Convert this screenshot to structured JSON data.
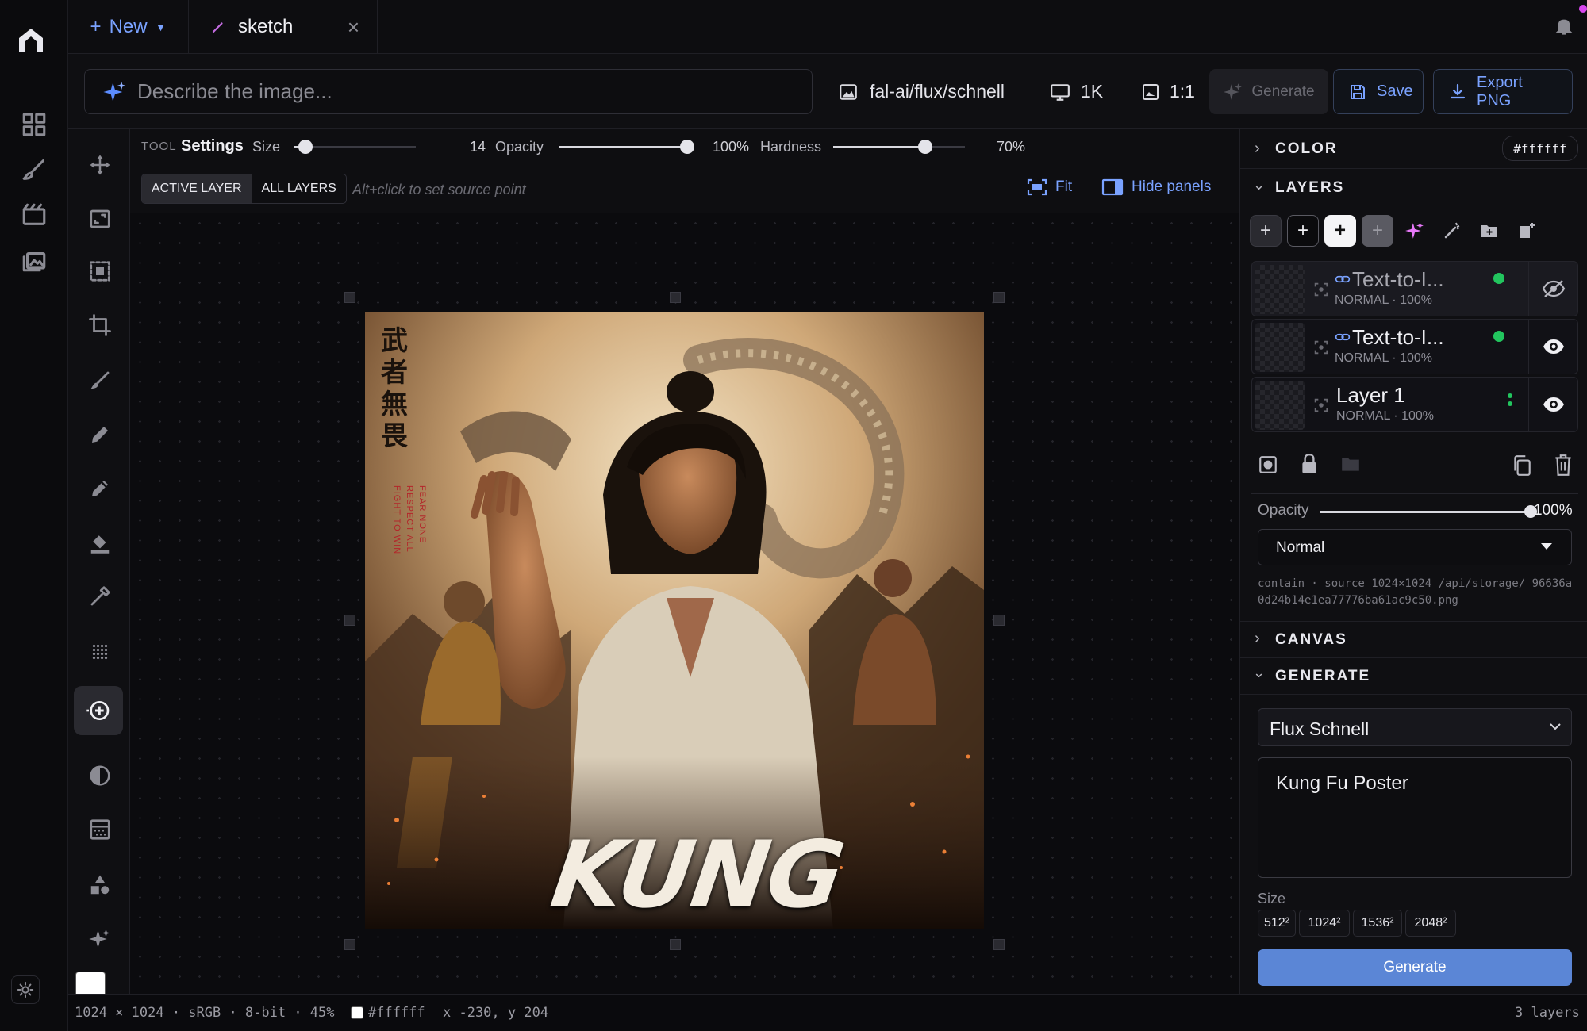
{
  "tabs": {
    "new_label": "New",
    "active_tab": "sketch"
  },
  "prompt": {
    "placeholder": "Describe the image..."
  },
  "toolbar": {
    "model": "fal-ai/flux/schnell",
    "resolution": "1K",
    "aspect": "1:1",
    "generate": "Generate",
    "save": "Save",
    "export": "Export PNG"
  },
  "options": {
    "tool_caption": "TOOL",
    "settings": "Settings",
    "size_label": "Size",
    "size_value": "14",
    "size_fraction": 0.1,
    "opacity_label": "Opacity",
    "opacity_value": "100%",
    "opacity_fraction": 1.0,
    "hardness_label": "Hardness",
    "hardness_value": "70%",
    "hardness_fraction": 0.7,
    "active_layer": "ACTIVE LAYER",
    "all_layers": "ALL LAYERS",
    "hint": "Alt+click to set source point",
    "fit": "Fit",
    "hide_panels": "Hide panels"
  },
  "poster": {
    "title": "KUNG FU",
    "kanji": "武者無畏",
    "taglines": [
      "FEAR NONE",
      "RESPECT ALL",
      "FIGHT TO WIN"
    ]
  },
  "right": {
    "color": {
      "label": "COLOR",
      "value": "#ffffff"
    },
    "layers": {
      "label": "LAYERS",
      "items": [
        {
          "name": "Text-to-I...",
          "sub": "NORMAL · 100%",
          "visible": false,
          "status_color": "#22c55e"
        },
        {
          "name": "Text-to-I...",
          "sub": "NORMAL · 100%",
          "visible": true,
          "status_color": "#22c55e"
        },
        {
          "name": "Layer 1",
          "sub": "NORMAL · 100%",
          "visible": true,
          "status_color": "#22c55e"
        }
      ]
    },
    "opacity_label": "Opacity",
    "opacity_value": "100%",
    "opacity_fraction": 1.0,
    "blend_mode": "Normal",
    "source_info": "contain · source 1024×1024 /api/storage/ 96636a0d24b14e1ea77776ba61ac9c50.png",
    "canvas_label": "CANVAS",
    "generate": {
      "label": "GENERATE",
      "model": "Flux Schnell",
      "prompt": "Kung Fu Poster",
      "size_label": "Size",
      "sizes": [
        "512²",
        "1024²",
        "1536²",
        "2048²"
      ],
      "button": "Generate"
    }
  },
  "status": {
    "info": "1024 × 1024 · sRGB · 8-bit · 45%",
    "color": "#ffffff",
    "coords": "x -230, y 204",
    "layers": "3 layers"
  },
  "colors": {
    "accent": "#7aa2ff",
    "generate_button": "#5b86d6",
    "status_green": "#22c55e",
    "swatch": "#ffffff"
  }
}
